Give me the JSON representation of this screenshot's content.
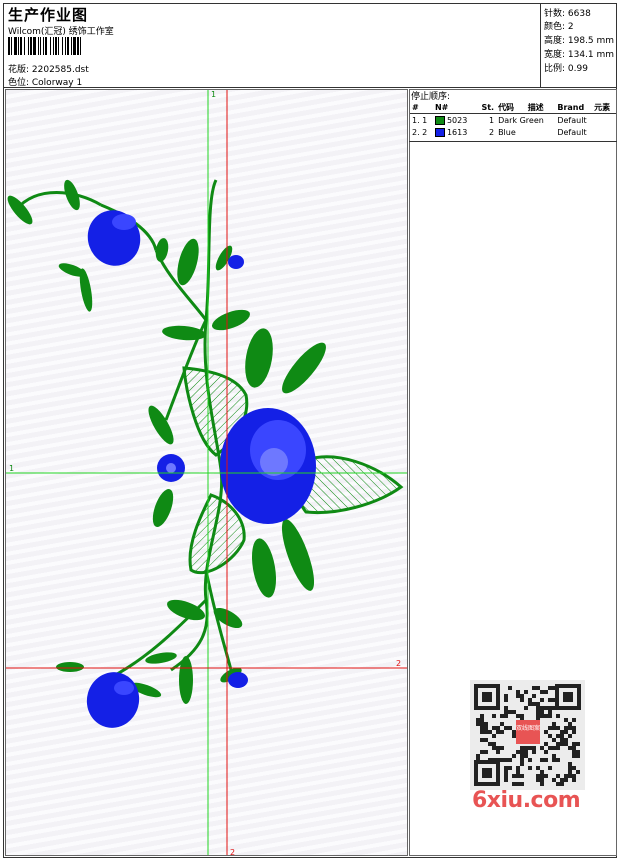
{
  "header": {
    "title": "生产作业图",
    "subtitle": "Wilcom(汇冠) 绣饰工作室",
    "pattern_label": "花版: 2202585.dst",
    "colorway_label": "色位: Colorway 1"
  },
  "stats": {
    "stitches": "针数: 6638",
    "colors": "颜色: 2",
    "height": "高度: 198.5 mm",
    "width": "宽度: 134.1 mm",
    "scale": "比例: 0.99"
  },
  "stop_sequence": {
    "title": "停止顺序:",
    "headers": [
      "#",
      "N#",
      "St.",
      "代码",
      "描述",
      "Brand",
      "元素"
    ],
    "rows": [
      {
        "index": "1. 1",
        "color": "#0f8a14",
        "code": "5023",
        "num": "1",
        "desc": "Dark Green",
        "brand": "Default"
      },
      {
        "index": "2. 2",
        "color": "#1420e6",
        "code": "1613",
        "num": "2",
        "desc": "Blue",
        "brand": "Default"
      }
    ]
  },
  "axes": {
    "green_v_label": "1",
    "green_h_label": "1",
    "red_h_label": "2",
    "red_v_label": "2"
  },
  "palette": {
    "green": "#0f8a14",
    "blue": "#1420e6",
    "red_guide": "#e01010",
    "green_guide": "#22d422"
  },
  "watermark": {
    "text": "6xiu.com",
    "stamp_text": "双线图案"
  }
}
